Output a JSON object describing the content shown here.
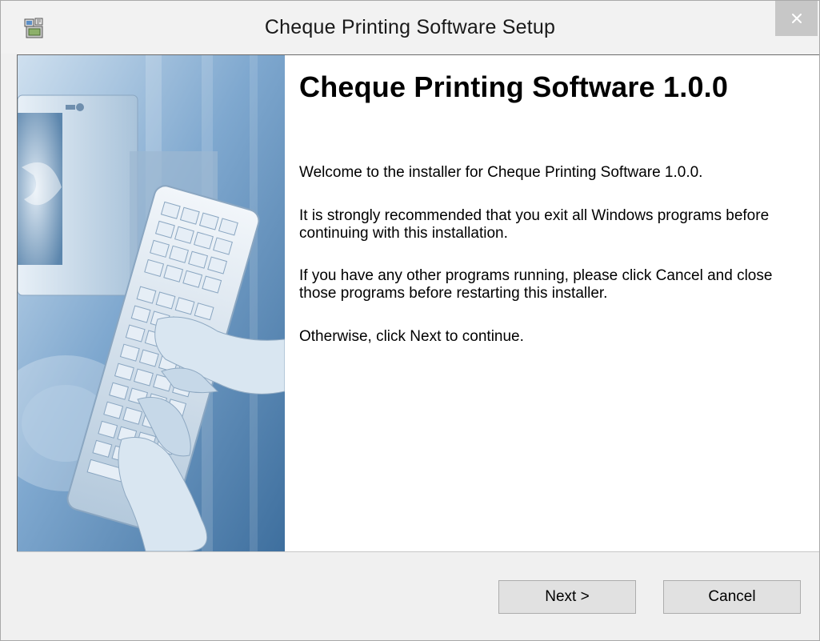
{
  "window": {
    "title": "Cheque Printing Software Setup",
    "close_glyph": "✕",
    "icon": "installer-icon"
  },
  "welcome": {
    "heading": "Cheque Printing Software 1.0.0",
    "paragraphs": [
      "Welcome to the installer for Cheque Printing Software 1.0.0.",
      "It is strongly recommended that you exit all Windows programs before continuing with this installation.",
      "If you have any other programs running, please click Cancel and close those programs before restarting this installer.",
      "Otherwise, click Next to continue."
    ],
    "side_image": "computer-keyboard-hands-illustration"
  },
  "buttons": {
    "next_label": "Next >",
    "cancel_label": "Cancel"
  },
  "colors": {
    "side_image_tint": "#7aa4c8",
    "close_button_bg": "#c7c7c7"
  }
}
